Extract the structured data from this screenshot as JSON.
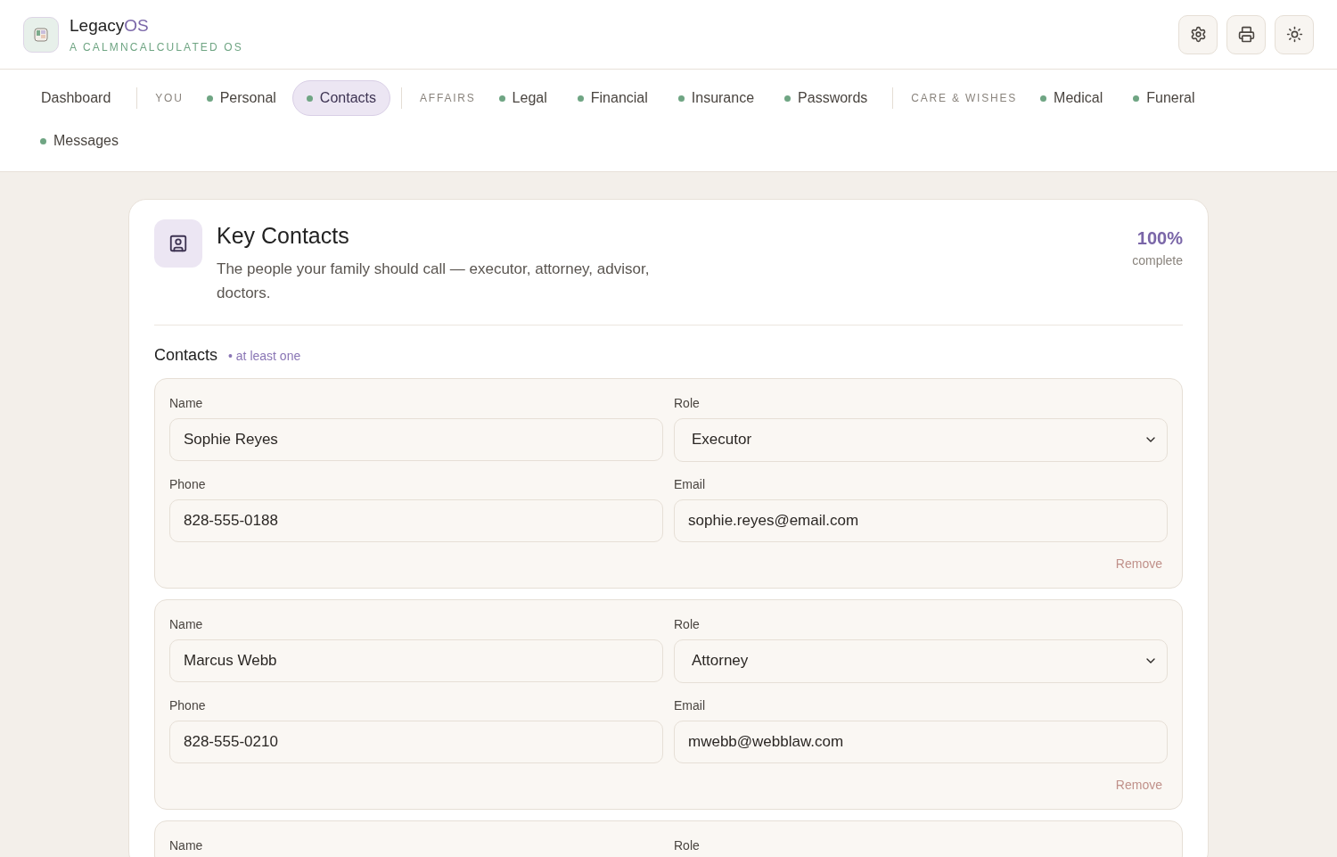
{
  "brand": {
    "name": "Legacy",
    "name_accent": "OS",
    "tagline": "A CALMNCALCULATED OS"
  },
  "nav": [
    {
      "kind": "link",
      "label": "Dashboard",
      "selected": false
    },
    {
      "kind": "group",
      "label": "YOU"
    },
    {
      "kind": "section",
      "label": "Personal",
      "selected": false
    },
    {
      "kind": "section",
      "label": "Contacts",
      "selected": true
    },
    {
      "kind": "group",
      "label": "AFFAIRS"
    },
    {
      "kind": "section",
      "label": "Legal",
      "selected": false
    },
    {
      "kind": "section",
      "label": "Financial",
      "selected": false
    },
    {
      "kind": "section",
      "label": "Insurance",
      "selected": false
    },
    {
      "kind": "section",
      "label": "Passwords",
      "selected": false
    },
    {
      "kind": "group",
      "label": "CARE & WISHES"
    },
    {
      "kind": "section",
      "label": "Medical",
      "selected": false
    },
    {
      "kind": "section",
      "label": "Funeral",
      "selected": false
    },
    {
      "kind": "section",
      "label": "Messages",
      "selected": false
    }
  ],
  "page": {
    "title": "Key Contacts",
    "description": "The people your family should call — executor, attorney, advisor, doctors.",
    "progress": "100%",
    "progress_label": "complete"
  },
  "section": {
    "title": "Contacts",
    "hint": "• at least one"
  },
  "contacts": [
    {
      "fields": [
        {
          "kind": "text",
          "label": "Name",
          "value": "Sophie Reyes"
        },
        {
          "kind": "select",
          "label": "Role",
          "value": "Executor"
        },
        {
          "kind": "text",
          "label": "Phone",
          "value": "828-555-0188"
        },
        {
          "kind": "text",
          "label": "Email",
          "value": "sophie.reyes@email.com"
        }
      ],
      "remove": "Remove"
    },
    {
      "fields": [
        {
          "kind": "text",
          "label": "Name",
          "value": "Marcus Webb"
        },
        {
          "kind": "select",
          "label": "Role",
          "value": "Attorney"
        },
        {
          "kind": "text",
          "label": "Phone",
          "value": "828-555-0210"
        },
        {
          "kind": "text",
          "label": "Email",
          "value": "mwebb@webblaw.com"
        }
      ],
      "remove": "Remove"
    },
    {
      "fields": [
        {
          "label": "Name"
        },
        {
          "label": "Role"
        }
      ]
    }
  ]
}
